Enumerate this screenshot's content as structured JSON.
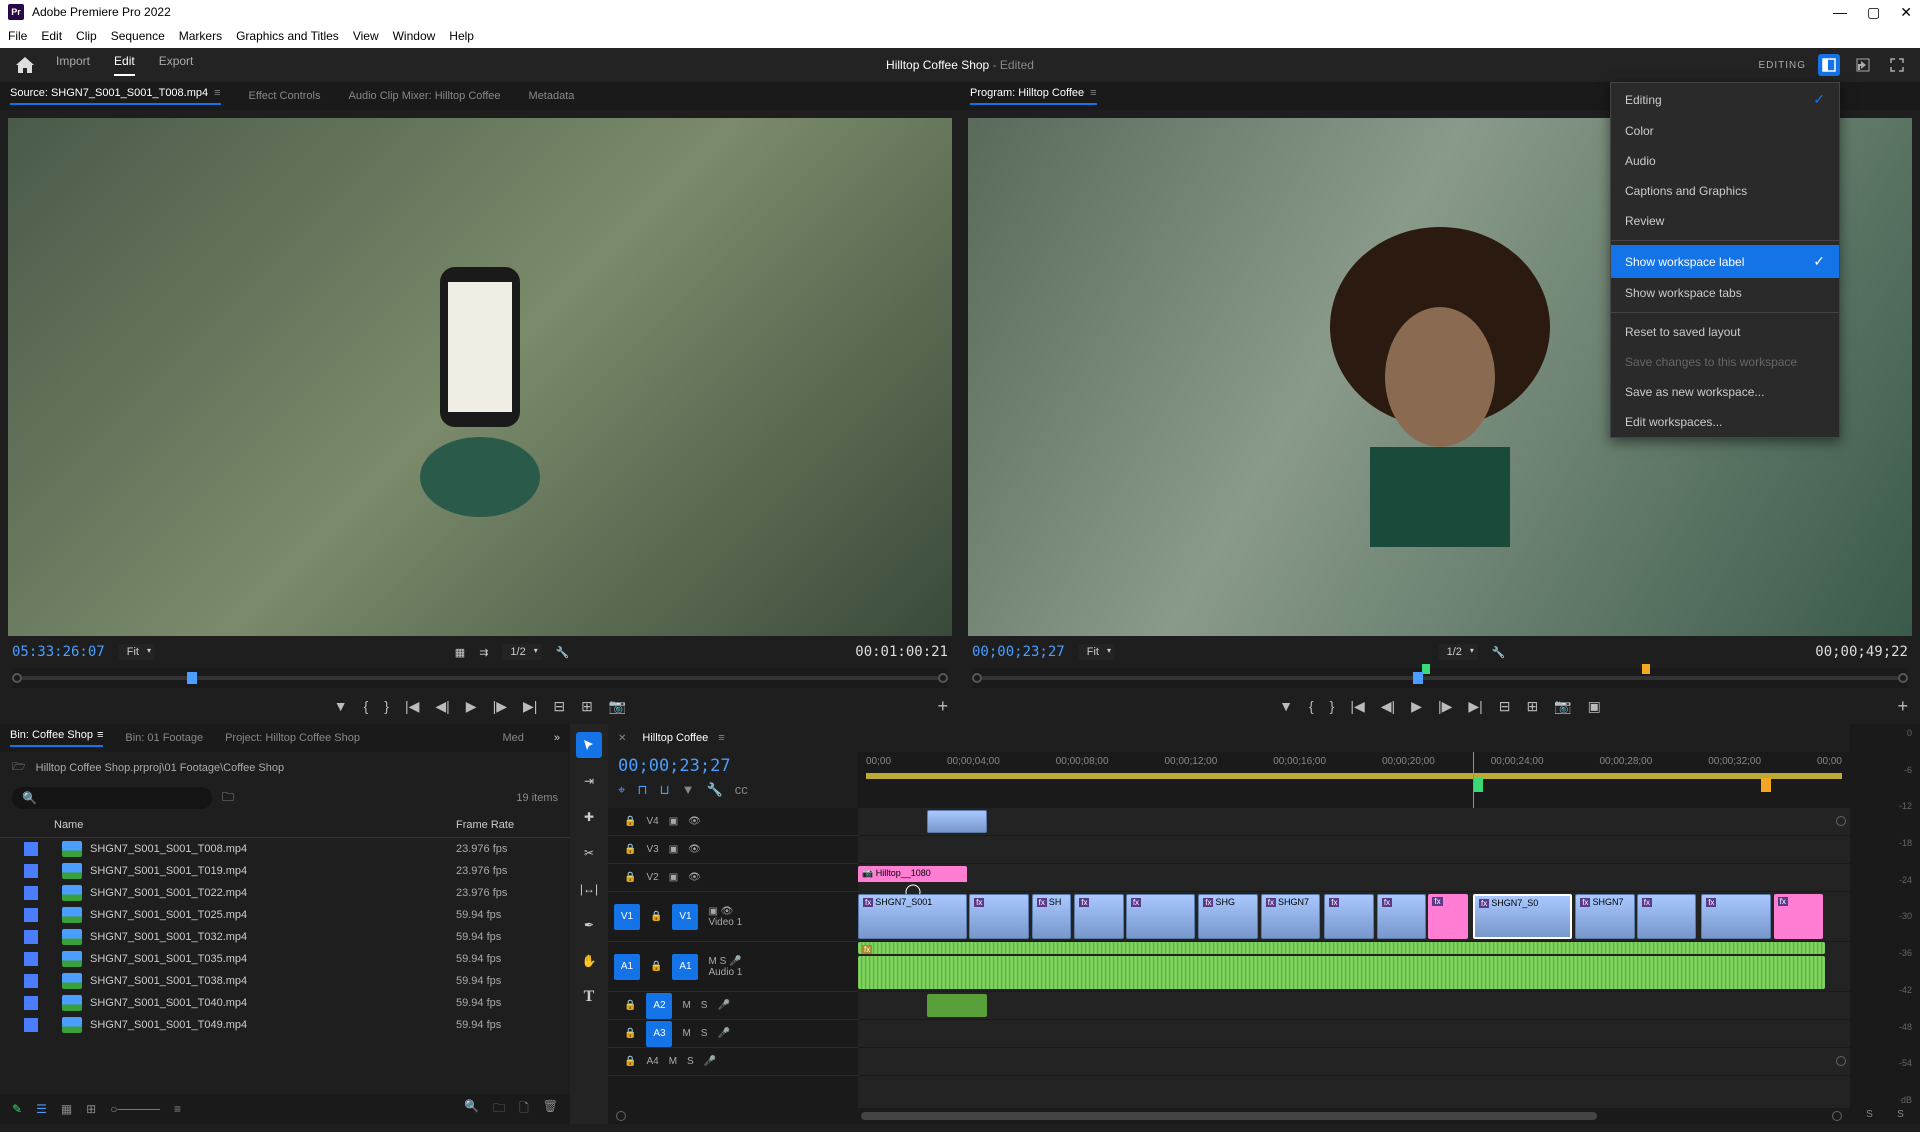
{
  "titlebar": {
    "app_name": "Adobe Premiere Pro 2022"
  },
  "menubar": [
    "File",
    "Edit",
    "Clip",
    "Sequence",
    "Markers",
    "Graphics and Titles",
    "View",
    "Window",
    "Help"
  ],
  "workspace": {
    "tabs": [
      "Import",
      "Edit",
      "Export"
    ],
    "active_tab": "Edit",
    "project_name": "Hilltop Coffee Shop",
    "edited_label": " - Edited",
    "current_label": "EDITING"
  },
  "source_panel": {
    "tabs": [
      "Source: SHGN7_S001_S001_T008.mp4",
      "Effect Controls",
      "Audio Clip Mixer: Hilltop Coffee",
      "Metadata"
    ],
    "timecode_in": "05:33:26:07",
    "fit": "Fit",
    "zoom": "1/2",
    "timecode_out": "00:01:00:21"
  },
  "program_panel": {
    "tabs": [
      "Program: Hilltop Coffee"
    ],
    "timecode_in": "00;00;23;27",
    "fit": "Fit",
    "zoom": "1/2",
    "timecode_out": "00;00;49;22"
  },
  "workspace_menu": {
    "items": [
      {
        "label": "Editing",
        "checked": true
      },
      {
        "label": "Color"
      },
      {
        "label": "Audio"
      },
      {
        "label": "Captions and Graphics"
      },
      {
        "label": "Review"
      }
    ],
    "section2": [
      {
        "label": "Show workspace label",
        "checked": true,
        "highlighted": true
      },
      {
        "label": "Show workspace tabs"
      }
    ],
    "section3": [
      {
        "label": "Reset to saved layout"
      },
      {
        "label": "Save changes to this workspace",
        "disabled": true
      },
      {
        "label": "Save as new workspace..."
      },
      {
        "label": "Edit workspaces..."
      }
    ]
  },
  "project": {
    "tabs": [
      "Bin: Coffee Shop",
      "Bin: 01 Footage",
      "Project: Hilltop Coffee Shop"
    ],
    "med_label": "Med",
    "path": "Hilltop Coffee Shop.prproj\\01 Footage\\Coffee Shop",
    "item_count": "19 items",
    "columns": {
      "name": "Name",
      "frame_rate": "Frame Rate"
    },
    "items": [
      {
        "name": "SHGN7_S001_S001_T008.mp4",
        "fps": "23.976 fps"
      },
      {
        "name": "SHGN7_S001_S001_T019.mp4",
        "fps": "23.976 fps"
      },
      {
        "name": "SHGN7_S001_S001_T022.mp4",
        "fps": "23.976 fps"
      },
      {
        "name": "SHGN7_S001_S001_T025.mp4",
        "fps": "59.94 fps"
      },
      {
        "name": "SHGN7_S001_S001_T032.mp4",
        "fps": "59.94 fps"
      },
      {
        "name": "SHGN7_S001_S001_T035.mp4",
        "fps": "59.94 fps"
      },
      {
        "name": "SHGN7_S001_S001_T038.mp4",
        "fps": "59.94 fps"
      },
      {
        "name": "SHGN7_S001_S001_T040.mp4",
        "fps": "59.94 fps"
      },
      {
        "name": "SHGN7_S001_S001_T049.mp4",
        "fps": "59.94 fps"
      }
    ]
  },
  "timeline": {
    "sequence_name": "Hilltop Coffee",
    "timecode": "00;00;23;27",
    "ruler_marks": [
      "00;00",
      "00;00;04;00",
      "00;00;08;00",
      "00;00;12;00",
      "00;00;16;00",
      "00;00;20;00",
      "00;00;24;00",
      "00;00;28;00",
      "00;00;32;00",
      "00;00"
    ],
    "tracks": {
      "v4": "V4",
      "v3": "V3",
      "v2": "V2",
      "v1": "V1",
      "video1": "Video 1",
      "a1": "A1",
      "audio1": "Audio 1",
      "a2": "A2",
      "a3": "A3",
      "a4": "A4",
      "m": "M",
      "s": "S"
    },
    "clips": {
      "v2_title": "Hilltop__1080",
      "v1_labels": [
        "SHGN7_S001",
        "SH",
        "SHG",
        "SHGN7",
        "SHGN7_S0",
        "SHGN7"
      ]
    }
  },
  "meters": {
    "scale": [
      "0",
      "-6",
      "-12",
      "-18",
      "-24",
      "-30",
      "-36",
      "-42",
      "-48",
      "-54",
      "dB"
    ],
    "footer": [
      "S",
      "S"
    ]
  }
}
